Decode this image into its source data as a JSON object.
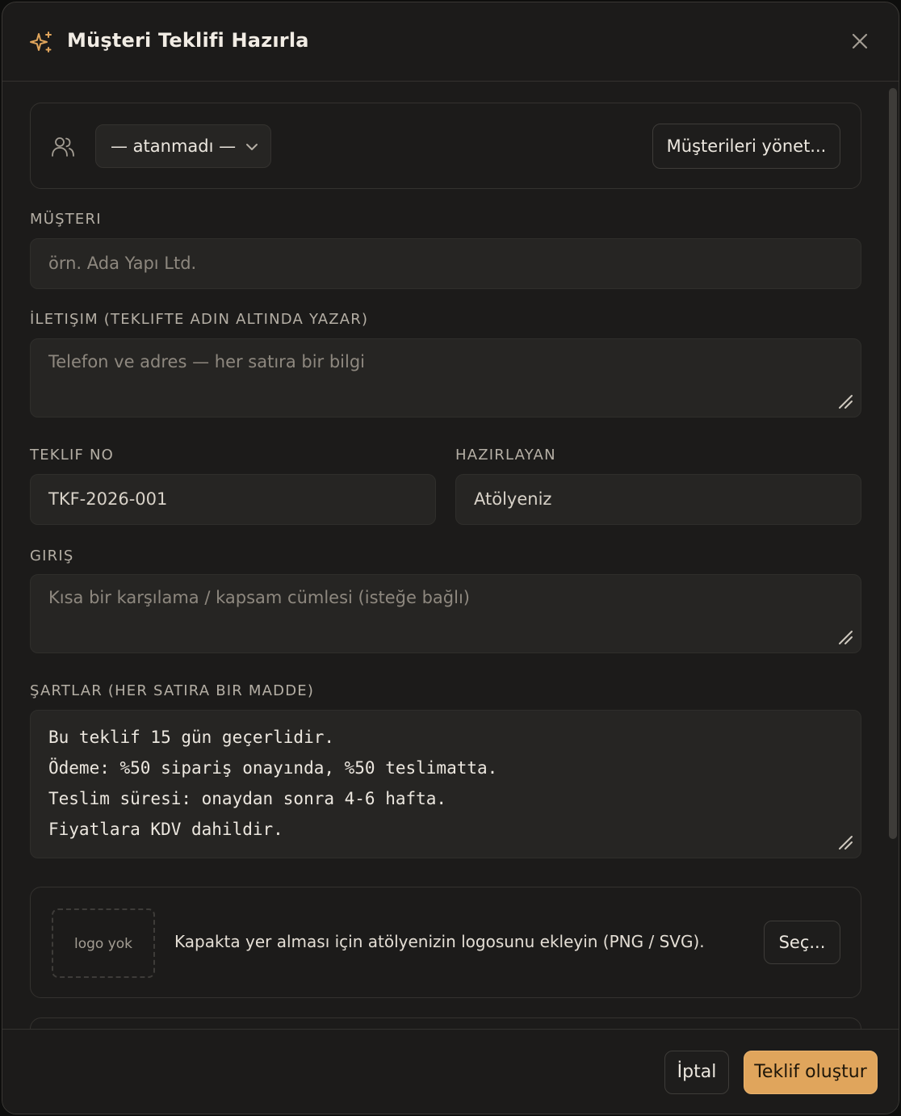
{
  "dialog": {
    "title": "Müşteri Teklifi Hazırla",
    "icons": {
      "title": "sparkle-icon",
      "close": "close-icon"
    }
  },
  "client_picker": {
    "icon": "users-icon",
    "selected": "— atanmadı —",
    "manage_label": "Müşterileri yönet..."
  },
  "fields": {
    "customer": {
      "label": "MÜŞTERI",
      "placeholder": "örn. Ada Yapı Ltd."
    },
    "contact": {
      "label": "İLETIŞIM (TEKLIFTE ADIN ALTINDA YAZAR)",
      "placeholder": "Telefon ve adres — her satıra bir bilgi"
    },
    "quote_no": {
      "label": "TEKLIF NO",
      "value": "TKF-2026-001"
    },
    "prepared_by": {
      "label": "HAZIRLAYAN",
      "value": "Atölyeniz"
    },
    "intro": {
      "label": "GIRIŞ",
      "placeholder": "Kısa bir karşılama / kapsam cümlesi (isteğe bağlı)"
    },
    "terms": {
      "label": "ŞARTLAR (HER SATIRA BIR MADDE)",
      "lines": [
        "Bu teklif 15 gün geçerlidir.",
        "Ödeme: %50 sipariş onayında, %50 teslimatta.",
        "Teslim süresi: onaydan sonra 4-6 hafta.",
        "Fiyatlara KDV dahildir."
      ]
    }
  },
  "logo": {
    "empty_label": "logo yok",
    "description": "Kapakta yer alması için atölyenizin logosunu ekleyin (PNG / SVG).",
    "choose_label": "Seç..."
  },
  "footer": {
    "cancel_label": "İptal",
    "submit_label": "Teklif oluştur"
  },
  "colors": {
    "accent": "#e0a55c",
    "background": "#1c1b1a",
    "field": "#262523"
  }
}
